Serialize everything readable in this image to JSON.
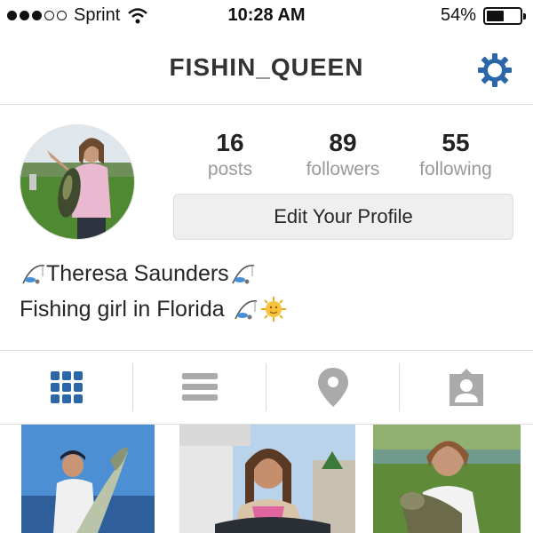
{
  "status_bar": {
    "carrier": "Sprint",
    "signal_bars_filled": 3,
    "signal_bars_total": 5,
    "time": "10:28 AM",
    "battery_percent": "54%",
    "battery_level": 0.54
  },
  "nav": {
    "username": "FISHIN_QUEEN",
    "settings_icon": "gear-icon",
    "accent_color": "#2b67a8"
  },
  "profile": {
    "stats": [
      {
        "number": "16",
        "label": "posts"
      },
      {
        "number": "89",
        "label": "followers"
      },
      {
        "number": "55",
        "label": "following"
      }
    ],
    "edit_button_label": "Edit Your Profile",
    "bio_name": "Theresa Saunders",
    "bio_text": "Fishing girl in Florida"
  },
  "tabs": [
    {
      "name": "grid-view",
      "icon": "grid-icon",
      "active": true
    },
    {
      "name": "list-view",
      "icon": "list-icon",
      "active": false
    },
    {
      "name": "map-view",
      "icon": "location-pin-icon",
      "active": false
    },
    {
      "name": "tagged-view",
      "icon": "person-tag-icon",
      "active": false
    }
  ],
  "colors": {
    "active_tab": "#2b67a8",
    "inactive_tab": "#aaaaaa"
  }
}
